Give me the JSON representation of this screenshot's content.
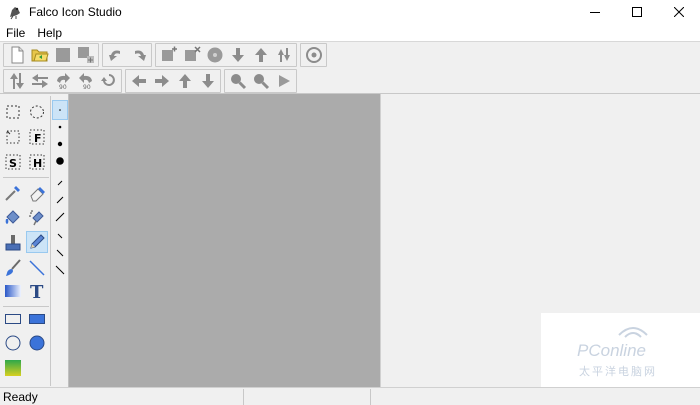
{
  "window": {
    "title": "Falco Icon Studio"
  },
  "menu": {
    "items": [
      "File",
      "Help"
    ]
  },
  "status": {
    "text": "Ready"
  },
  "watermark": {
    "brand": "PConline",
    "sub": "太平洋电脑网"
  },
  "colors": {
    "canvas": "#ababab",
    "panel": "#f0f0f0",
    "accent_blue": "#3b73d9",
    "arrow_gray": "#8c8c8c"
  }
}
